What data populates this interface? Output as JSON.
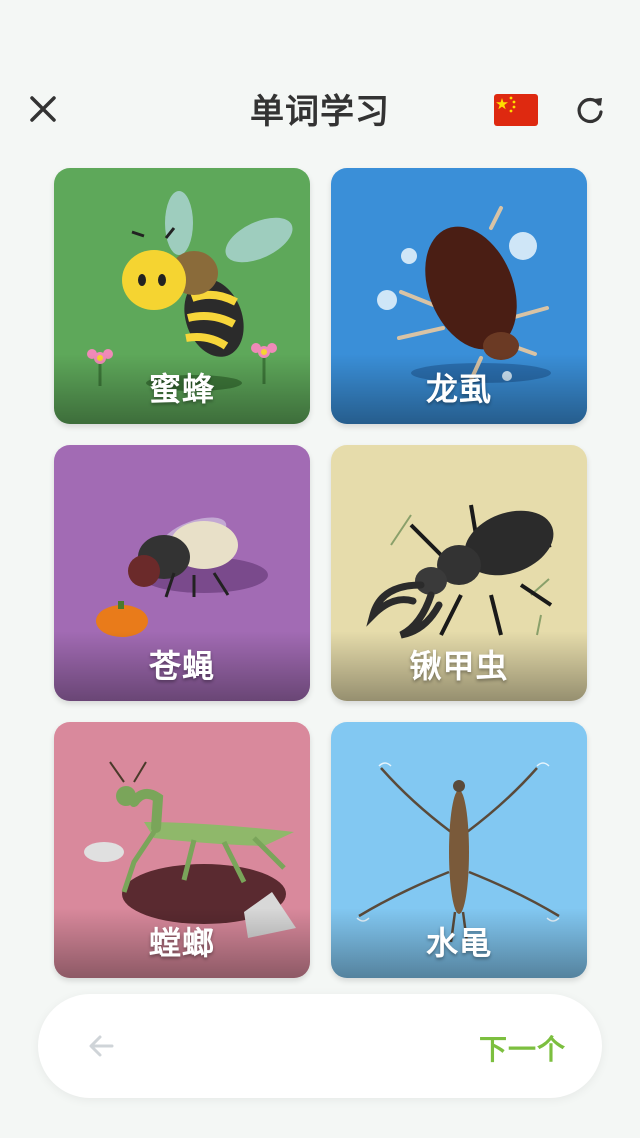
{
  "header": {
    "title": "单词学习",
    "close_icon": "close-icon",
    "flag_icon": "china-flag-icon",
    "refresh_icon": "refresh-icon"
  },
  "cards": [
    {
      "label": "蜜蜂",
      "color": "#5ea85a",
      "icon": "bee"
    },
    {
      "label": "龙虱",
      "color": "#3a8fd8",
      "icon": "diving-beetle"
    },
    {
      "label": "苍蝇",
      "color": "#a26bb4",
      "icon": "fly"
    },
    {
      "label": "锹甲虫",
      "color": "#e6dcab",
      "icon": "stag-beetle"
    },
    {
      "label": "螳螂",
      "color": "#d9899c",
      "icon": "mantis"
    },
    {
      "label": "水黾",
      "color": "#82c8f2",
      "icon": "water-strider"
    }
  ],
  "footer": {
    "prev_icon": "arrow-left-icon",
    "next_label": "下一个",
    "next_color": "#7cbf3f"
  }
}
